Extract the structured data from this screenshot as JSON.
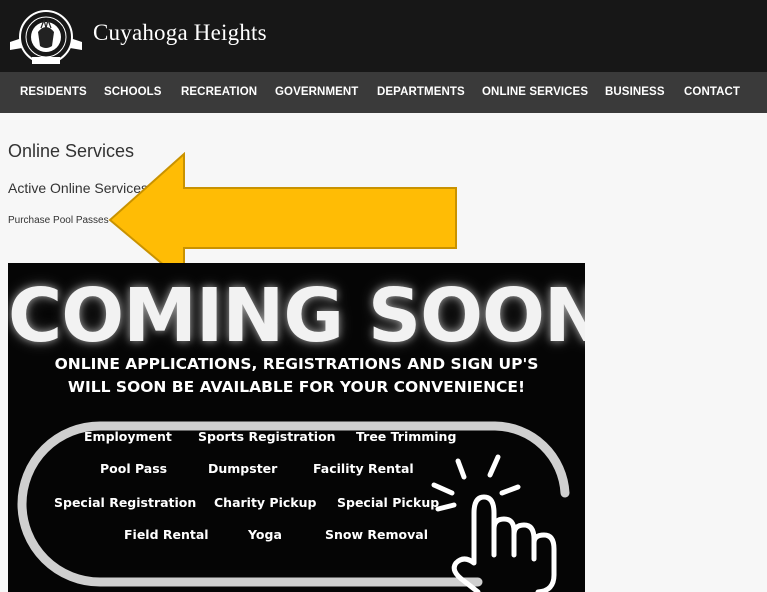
{
  "site": {
    "title": "Cuyahoga Heights",
    "logo_label": "logo-seal"
  },
  "nav": {
    "items": [
      {
        "label": "RESIDENTS"
      },
      {
        "label": "SCHOOLS"
      },
      {
        "label": "RECREATION"
      },
      {
        "label": "GOVERNMENT"
      },
      {
        "label": "DEPARTMENTS"
      },
      {
        "label": "ONLINE SERVICES"
      },
      {
        "label": "BUSINESS"
      },
      {
        "label": "CONTACT"
      }
    ]
  },
  "main": {
    "heading": "Online Services",
    "subheading": "Active Online Services L",
    "link": "Purchase Pool Passes"
  },
  "banner": {
    "headline": "COMING SOON!",
    "line1": "ONLINE APPLICATIONS, REGISTRATIONS AND SIGN UP'S",
    "line2": "WILL SOON BE AVAILABLE FOR YOUR CONVENIENCE!",
    "services": [
      "Employment",
      "Sports Registration",
      "Tree Trimming",
      "Pool Pass",
      "Dumpster",
      "Facility Rental",
      "Special Registration",
      "Charity Pickup",
      "Special Pickup",
      "Field Rental",
      "Yoga",
      "Snow Removal"
    ]
  },
  "colors": {
    "header_bg": "#171717",
    "nav_bg": "#3a3a3a",
    "arrow_fill": "#ffbc05",
    "banner_bg": "#050505"
  }
}
